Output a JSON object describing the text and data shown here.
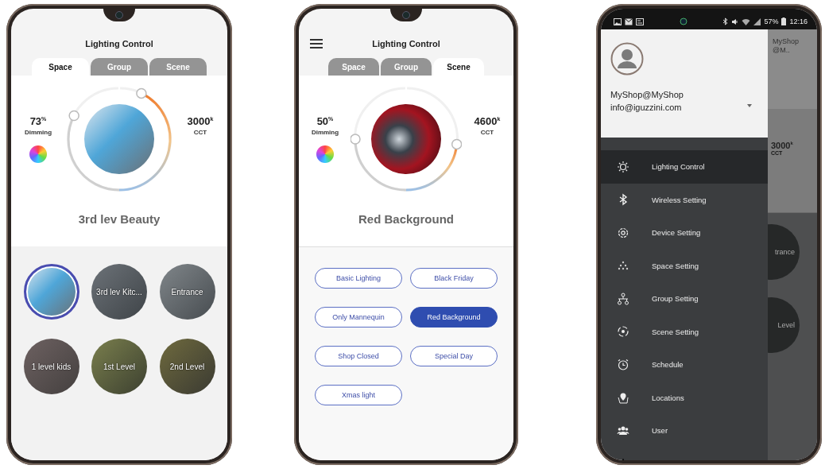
{
  "space_screen": {
    "title": "Lighting Control",
    "tabs": [
      {
        "label": "Space",
        "selected": true
      },
      {
        "label": "Group",
        "selected": false
      },
      {
        "label": "Scene",
        "selected": false
      }
    ],
    "dial": {
      "dimming": {
        "value": "73$^{%}$",
        "label": "Dimming",
        "level": 0.73
      },
      "cct": {
        "value": "3000$^{k}$",
        "label": "CCT",
        "level": 0.95
      }
    },
    "name": "3rd lev Beauty",
    "spaces": [
      {
        "selected": true
      },
      {
        "label": "3rd lev Kitc...",
        "selected": false
      },
      {
        "label": "Entrance",
        "selected": false
      },
      {
        "label": "1 level kids",
        "selected": false
      },
      {
        "label": "1st Level",
        "selected": false
      },
      {
        "label": "2nd Level",
        "selected": false
      }
    ]
  },
  "scene_screen": {
    "title": "Lighting Control",
    "tabs": [
      {
        "label": "Space",
        "selected": false
      },
      {
        "label": "Group",
        "selected": false
      },
      {
        "label": "Scene",
        "selected": true
      }
    ],
    "dial": {
      "dimming": {
        "value": "50$^{%}$",
        "label": "Dimming",
        "level": 0.5
      },
      "cct": {
        "value": "4600$^{k}$",
        "label": "CCT",
        "level": 0.45
      }
    },
    "name": "Red Background",
    "scenes": [
      {
        "label": "Basic Lighting",
        "selected": false
      },
      {
        "label": "Black Friday",
        "selected": false
      },
      {
        "label": "Only Mannequin",
        "selected": false
      },
      {
        "label": "Red Background",
        "selected": true
      },
      {
        "label": "Shop Closed",
        "selected": false
      },
      {
        "label": "Special Day",
        "selected": false
      },
      {
        "label": "Xmas light",
        "selected": false
      }
    ]
  },
  "drawer_screen": {
    "status_bar": {
      "battery": "57%",
      "time": "12:16"
    },
    "account": {
      "name": "MyShop@MyShop",
      "email": "info@iguzzini.com"
    },
    "menu": [
      {
        "label": "Lighting Control",
        "selected": true
      },
      {
        "label": "Wireless Setting",
        "selected": false
      },
      {
        "label": "Device Setting",
        "selected": false
      },
      {
        "label": "Space Setting",
        "selected": false
      },
      {
        "label": "Group Setting",
        "selected": false
      },
      {
        "label": "Scene Setting",
        "selected": false
      },
      {
        "label": "Schedule",
        "selected": false
      },
      {
        "label": "Locations",
        "selected": false
      },
      {
        "label": "User",
        "selected": false
      },
      {
        "selected": false
      }
    ],
    "background": {
      "header_text": "MyShop@M..",
      "cct_value": "3000$^{k}$",
      "cct_label": "CCT",
      "tiles": [
        "trance",
        "Level"
      ]
    }
  }
}
